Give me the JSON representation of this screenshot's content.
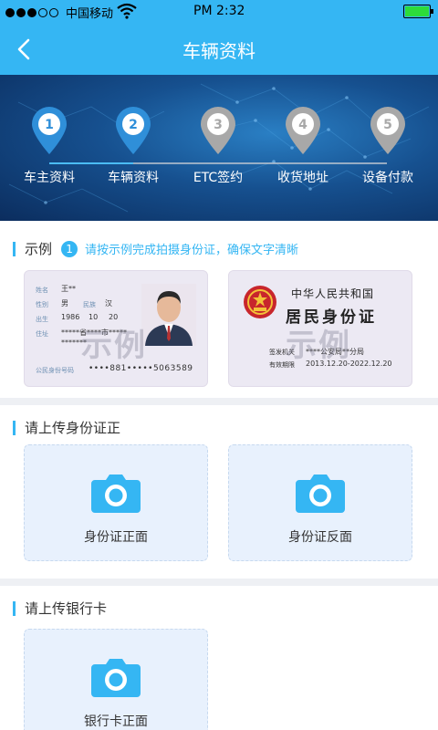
{
  "status": {
    "carrier": "中国移动",
    "time": "PM 2:32",
    "signal_dots_filled": 3,
    "signal_dots_total": 5
  },
  "nav": {
    "title": "车辆资料",
    "back_icon": "chevron-left-icon"
  },
  "steps": [
    {
      "num": "1",
      "label": "车主资料",
      "done": true
    },
    {
      "num": "2",
      "label": "车辆资料",
      "done": true
    },
    {
      "num": "3",
      "label": "ETC签约",
      "done": false
    },
    {
      "num": "4",
      "label": "收货地址",
      "done": false
    },
    {
      "num": "5",
      "label": "设备付款",
      "done": false
    }
  ],
  "example": {
    "title": "示例",
    "hint_num": "1",
    "hint": "请按示例完成拍摄身份证，确保文字清晰",
    "watermark": "示例",
    "front": {
      "name_label": "姓名",
      "name": "王**",
      "gender_label": "性别",
      "gender": "男",
      "ethnic_label": "民族",
      "ethnic": "汉",
      "birth_label": "出生",
      "birth_year": "1986",
      "birth_month": "10",
      "birth_day": "20",
      "address_label": "住址",
      "address_line1": "*****省****市*****",
      "address_line2": "*******",
      "id_label": "公民身份号码",
      "id_number": "••••881•••••5063589"
    },
    "back": {
      "country": "中华人民共和国",
      "card_title": "居民身份证",
      "issuer_label": "签发机关",
      "issuer": "****公安局**分局",
      "valid_label": "有效期限",
      "valid": "2013.12.20-2022.12.20"
    }
  },
  "upload_id": {
    "title": "请上传身份证正",
    "front_label": "身份证正面",
    "back_label": "身份证反面"
  },
  "upload_bank": {
    "title": "请上传银行卡",
    "front_label": "银行卡正面"
  },
  "colors": {
    "accent": "#35b6f3",
    "step_done": "#2f8fd9",
    "step_todo": "#a8a8a8",
    "card_bg": "#e8f1fd"
  }
}
